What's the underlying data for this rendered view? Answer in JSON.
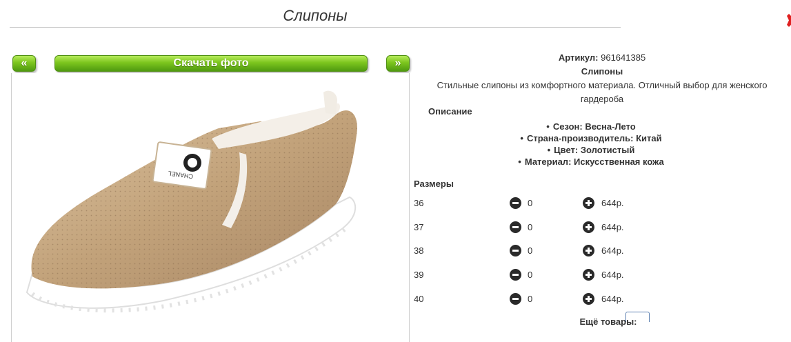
{
  "header": {
    "title": "Слипоны"
  },
  "nav": {
    "prev": "«",
    "download": "Скачать фото",
    "next": "»"
  },
  "product": {
    "sku_label": "Артикул:",
    "sku_value": "961641385",
    "name": "Слипоны",
    "description_line1": "Стильные слипоны из комфортного материала. Отличный выбор для женского",
    "description_line2": "гардероба"
  },
  "specs": {
    "title": "Описание",
    "items": [
      "Сезон: Весна-Лето",
      "Страна-производитель: Китай",
      "Цвет: Золотистый",
      "Материал: Искусственная кожа"
    ]
  },
  "sizes": {
    "title": "Размеры",
    "rows": [
      {
        "size": "36",
        "qty": "0",
        "price": "644р."
      },
      {
        "size": "37",
        "qty": "0",
        "price": "644р."
      },
      {
        "size": "38",
        "qty": "0",
        "price": "644р."
      },
      {
        "size": "39",
        "qty": "0",
        "price": "644р."
      },
      {
        "size": "40",
        "qty": "0",
        "price": "644р."
      }
    ]
  },
  "more": {
    "title": "Ещё товары:"
  },
  "colors": {
    "accent_green": "#7cc51e",
    "product_gold": "#c9ab84"
  },
  "icons": {
    "corner": "close-x-icon",
    "minus": "minus-circle-icon",
    "plus": "plus-circle-icon"
  }
}
